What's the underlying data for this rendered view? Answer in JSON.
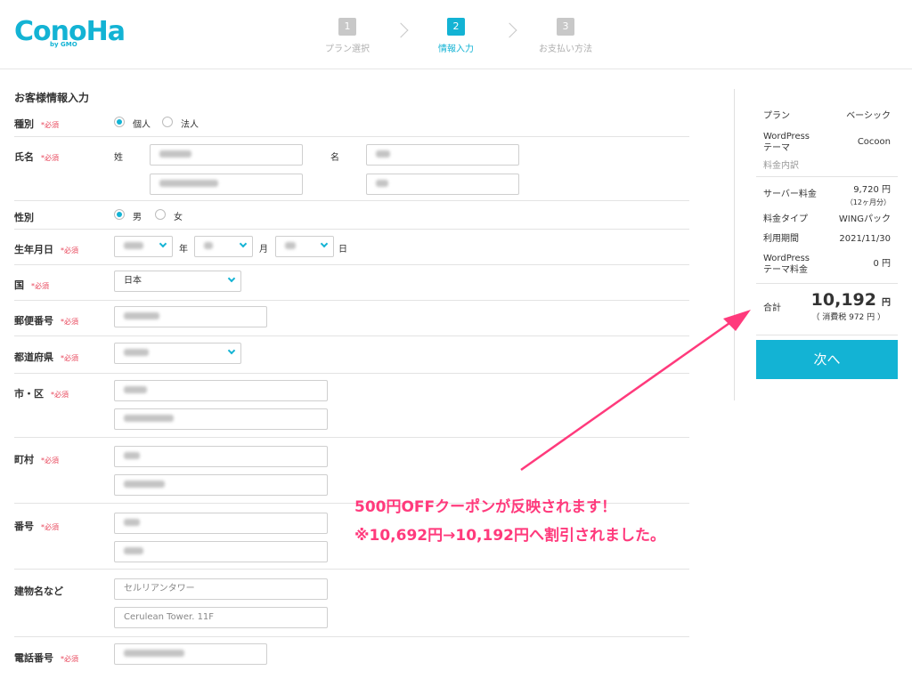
{
  "brand": {
    "logo": "ConoHa",
    "logo_sub": "by GMO"
  },
  "steps": [
    {
      "num": "1",
      "label": "プラン選択"
    },
    {
      "num": "2",
      "label": "情報入力"
    },
    {
      "num": "3",
      "label": "お支払い方法"
    }
  ],
  "form": {
    "title": "お客様情報入力",
    "required_mark": "*必須",
    "type": {
      "label": "種別",
      "options": [
        "個人",
        "法人"
      ],
      "selected": "個人"
    },
    "name": {
      "label": "氏名",
      "last_label": "姓",
      "first_label": "名"
    },
    "gender": {
      "label": "性別",
      "options": [
        "男",
        "女"
      ],
      "selected": "男"
    },
    "birth": {
      "label": "生年月日",
      "year_unit": "年",
      "month_unit": "月",
      "day_unit": "日"
    },
    "country": {
      "label": "国",
      "value": "日本"
    },
    "postal": {
      "label": "郵便番号"
    },
    "prefecture": {
      "label": "都道府県"
    },
    "city": {
      "label": "市・区"
    },
    "town": {
      "label": "町村"
    },
    "number": {
      "label": "番号"
    },
    "building": {
      "label": "建物名など",
      "placeholder1": "セルリアンタワー",
      "placeholder2": "Cerulean Tower. 11F"
    },
    "phone": {
      "label": "電話番号"
    }
  },
  "summary": {
    "plan_key": "プラン",
    "plan_value": "ベーシック",
    "theme_key": "WordPress\nテーマ",
    "theme_value": "Cocoon",
    "breakdown_label": "料金内訳",
    "server_key": "サーバー料金",
    "server_value": "9,720 円",
    "server_note": "（12ヶ月分）",
    "fee_type_key": "料金タイプ",
    "fee_type_value": "WINGパック",
    "period_key": "利用期間",
    "period_value": "2021/11/30",
    "theme_fee_key": "WordPress\nテーマ料金",
    "theme_fee_value": "0 円",
    "total_key": "合計",
    "total_value": "10,192",
    "total_unit": "円",
    "tax_note": "（ 消費税 972 円 ）",
    "next_button": "次へ"
  },
  "annotation": {
    "line1": "500円OFFクーポンが反映されます！",
    "line2": "※10,692円→10,192円へ割引されました。",
    "color": "#ff3a7c"
  },
  "colors": {
    "accent": "#13b3d4",
    "required": "#e8455a"
  }
}
